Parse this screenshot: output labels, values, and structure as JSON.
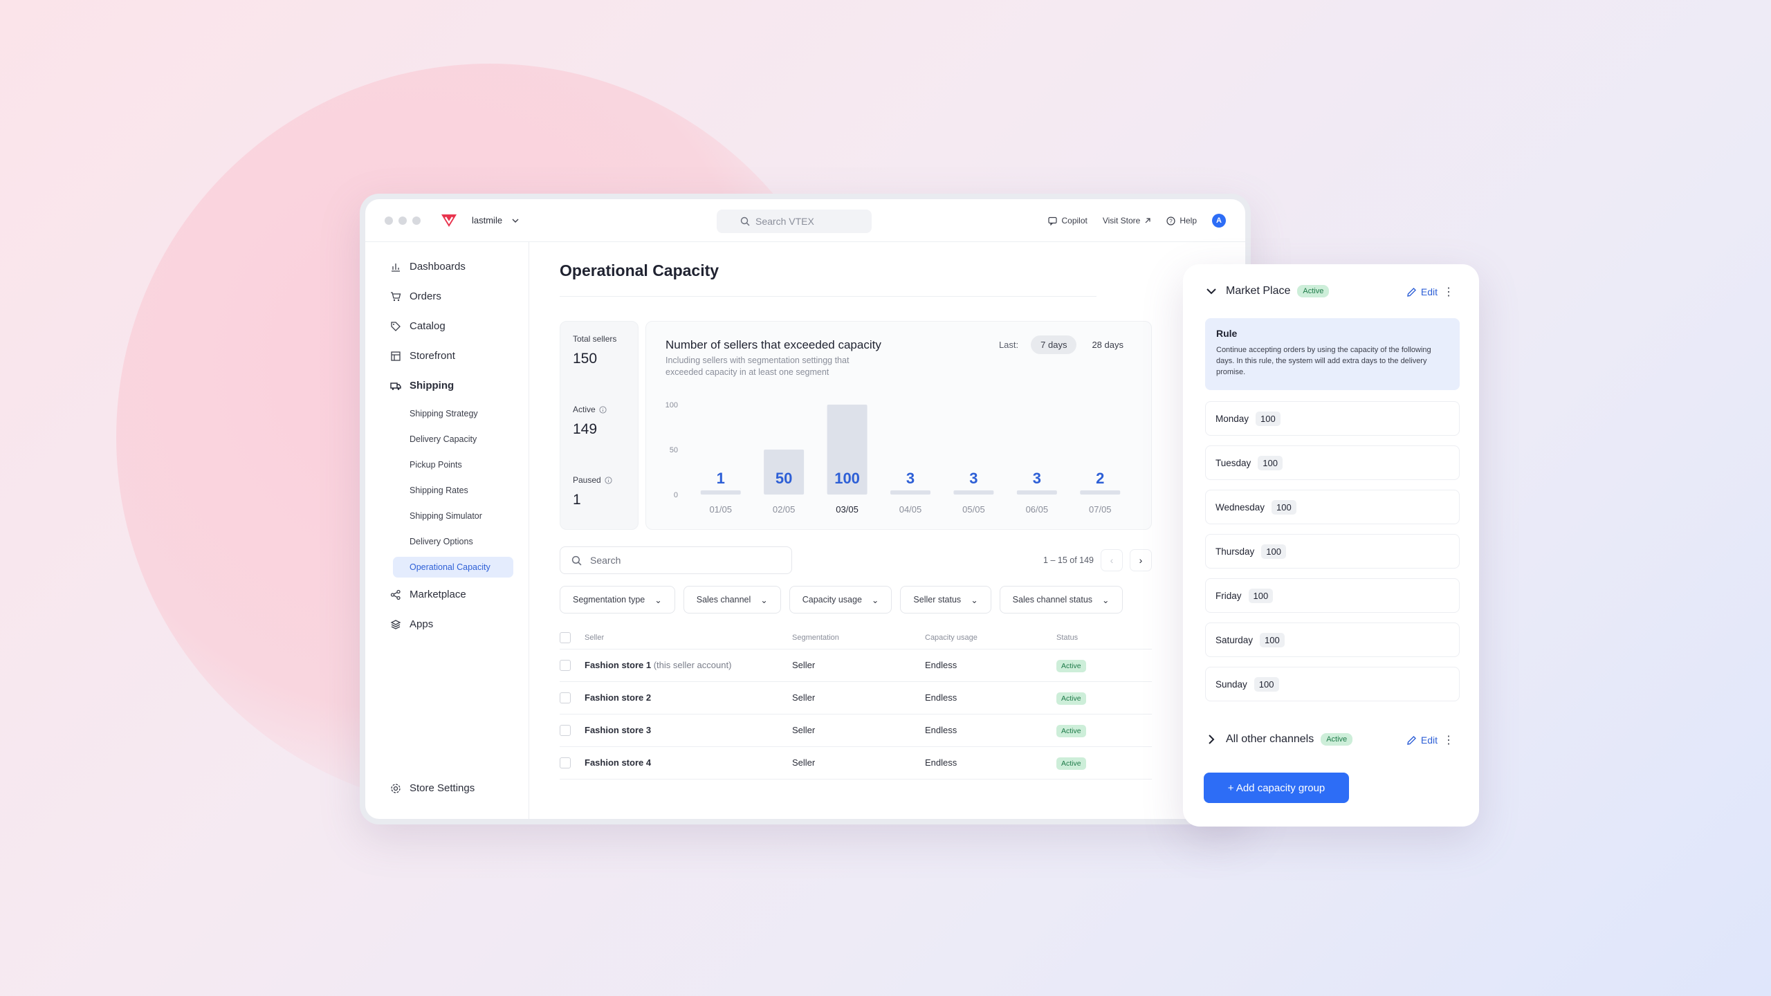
{
  "topbar": {
    "account": "lastmile",
    "search_placeholder": "Search VTEX",
    "copilot": "Copilot",
    "visit_store": "Visit Store",
    "help": "Help",
    "avatar": "A"
  },
  "sidebar": {
    "items": [
      {
        "label": "Dashboards",
        "icon": "bar-chart-icon"
      },
      {
        "label": "Orders",
        "icon": "cart-icon"
      },
      {
        "label": "Catalog",
        "icon": "tag-icon"
      },
      {
        "label": "Storefront",
        "icon": "layout-icon"
      },
      {
        "label": "Shipping",
        "icon": "truck-icon"
      }
    ],
    "shipping_sub": [
      "Shipping Strategy",
      "Delivery Capacity",
      "Pickup Points",
      "Shipping Rates",
      "Shipping Simulator",
      "Delivery Options",
      "Operational Capacity"
    ],
    "items_after": [
      {
        "label": "Marketplace",
        "icon": "share-icon"
      },
      {
        "label": "Apps",
        "icon": "layers-icon"
      }
    ],
    "store_settings": "Store Settings"
  },
  "main": {
    "title": "Operational Capacity",
    "stats": {
      "total_label": "Total sellers",
      "total_value": "150",
      "active_label": "Active",
      "active_value": "149",
      "paused_label": "Paused",
      "paused_value": "1"
    },
    "chart_header": {
      "title": "Number of sellers that exceeded capacity",
      "subtitle": "Including sellers with segmentation settingg that exceeded capacity in at least one segment",
      "last_label": "Last:",
      "range_7": "7 days",
      "range_28": "28 days"
    },
    "search_placeholder": "Search",
    "pager_text": "1 – 15 of 149",
    "filters": [
      "Segmentation type",
      "Sales channel",
      "Capacity usage",
      "Seller status",
      "Sales channel status"
    ],
    "columns": [
      "Seller",
      "Segmentation",
      "Capacity usage",
      "Status"
    ],
    "rows": [
      {
        "name": "Fashion store 1",
        "note": "(this seller account)",
        "segmentation": "Seller",
        "usage": "Endless",
        "status": "Active"
      },
      {
        "name": "Fashion store 2",
        "note": "",
        "segmentation": "Seller",
        "usage": "Endless",
        "status": "Active"
      },
      {
        "name": "Fashion store 3",
        "note": "",
        "segmentation": "Seller",
        "usage": "Endless",
        "status": "Active"
      },
      {
        "name": "Fashion store 4",
        "note": "",
        "segmentation": "Seller",
        "usage": "Endless",
        "status": "Active"
      }
    ]
  },
  "chart_data": {
    "type": "bar",
    "categories": [
      "01/05",
      "02/05",
      "03/05",
      "04/05",
      "05/05",
      "06/05",
      "07/05"
    ],
    "values": [
      1,
      50,
      100,
      3,
      3,
      3,
      2
    ],
    "highlight_category": "03/05",
    "y_ticks": [
      "100",
      "50",
      "0"
    ],
    "ylim": [
      0,
      100
    ],
    "bar_color": "#dde1ea",
    "label_color": "#2d5fd6"
  },
  "panel": {
    "group1": {
      "name": "Market Place",
      "status": "Active",
      "edit": "Edit"
    },
    "rule_title": "Rule",
    "rule_text": "Continue accepting orders by using the capacity of the following days. In this rule, the system will add extra days to the delivery promise.",
    "days": [
      {
        "day": "Monday",
        "value": "100"
      },
      {
        "day": "Tuesday",
        "value": "100"
      },
      {
        "day": "Wednesday",
        "value": "100"
      },
      {
        "day": "Thursday",
        "value": "100"
      },
      {
        "day": "Friday",
        "value": "100"
      },
      {
        "day": "Saturday",
        "value": "100"
      },
      {
        "day": "Sunday",
        "value": "100"
      }
    ],
    "group2": {
      "name": "All other channels",
      "status": "Active",
      "edit": "Edit"
    },
    "add_button": "+ Add capacity group"
  },
  "colors": {
    "accent": "#2d6df6",
    "active_bg": "#cdeed9",
    "active_text": "#1d7a48",
    "brand": "#e8344e"
  }
}
